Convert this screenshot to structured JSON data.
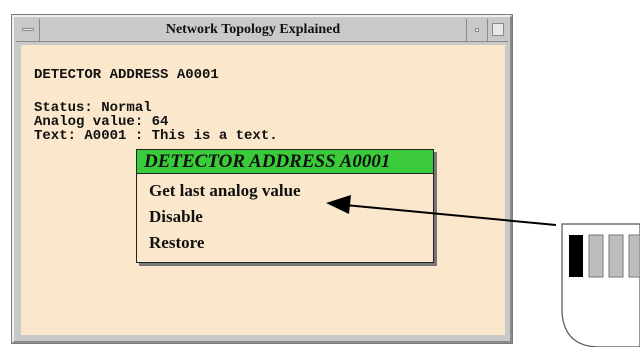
{
  "window": {
    "title": "Network Topology Explained"
  },
  "content": {
    "lines": [
      "DETECTOR ADDRESS A0001",
      "Status: Normal",
      "Analog value: 64",
      "Text: A0001 : This is a text."
    ]
  },
  "context_menu": {
    "header": "DETECTOR ADDRESS A0001",
    "items": [
      "Get last analog value",
      "Disable",
      "Restore"
    ]
  },
  "icons": [
    "window-menu-icon",
    "minimize-icon",
    "maximize-icon",
    "arrow-pointer-icon",
    "detector-device-icon"
  ],
  "colors": {
    "window_frame": "#c9c9c9",
    "content_bg": "#fbe7cc",
    "menu_header": "#3aca3a"
  }
}
